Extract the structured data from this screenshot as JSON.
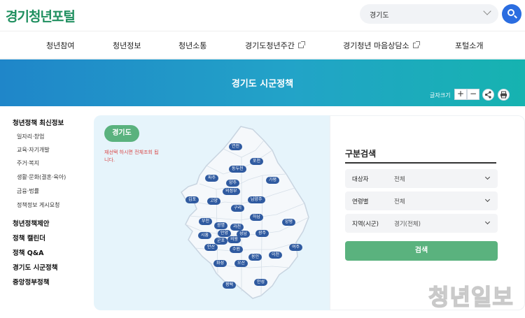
{
  "header": {
    "logo": "경기청년포털",
    "search_select_value": "경기도"
  },
  "nav": {
    "items": [
      "청년참여",
      "청년정보",
      "청년소통",
      "경기도청년주간",
      "경기청년 마음상담소",
      "포털소개"
    ]
  },
  "banner": {
    "title": "경기도 시군정책",
    "font_size_label": "글자크기",
    "plus": "+",
    "minus": "−"
  },
  "sidebar": {
    "sections": [
      {
        "label": "청년정책 최신정보",
        "items": [
          "일자리·창업",
          "교육·자기개발",
          "주거·복지",
          "생활·문화(결혼·육아)",
          "금융·법률",
          "정책정보 게시요청"
        ]
      },
      {
        "label": "청년정책제안",
        "items": []
      },
      {
        "label": "정책 캘린더",
        "items": []
      },
      {
        "label": "정책 Q&A",
        "items": []
      },
      {
        "label": "경기도 시군정책",
        "items": []
      },
      {
        "label": "중앙정부정책",
        "items": []
      }
    ]
  },
  "map": {
    "badge": "경기도",
    "note": "재선택 하시면 전체조회 됩니다.",
    "regions": [
      "연천",
      "포천",
      "동두천",
      "파주",
      "양주",
      "가평",
      "의정부",
      "김포",
      "고양",
      "구리",
      "남양주",
      "하남",
      "양평",
      "부천",
      "광명",
      "과천",
      "안양",
      "성남",
      "광주",
      "시흥",
      "군포",
      "의왕",
      "안산",
      "수원",
      "여주",
      "이천",
      "화성",
      "오산",
      "용인",
      "평택",
      "안성"
    ],
    "colors": {
      "region_tag": "#2f5aa0",
      "map_fill": "#f5f8fb",
      "panel_bg": "#e6f4fb"
    }
  },
  "search": {
    "title": "구분검색",
    "fields": [
      {
        "label": "대상자",
        "value": "전체"
      },
      {
        "label": "연령별",
        "value": "전체"
      },
      {
        "label": "지역(시군)",
        "value": "경기(전체)"
      }
    ],
    "button": "검색"
  },
  "watermark": "청년일보",
  "colors": {
    "accent_green": "#5ab27e",
    "accent_blue": "#2b6de0",
    "banner_start": "#1f86c9",
    "banner_end": "#16b3b0"
  }
}
